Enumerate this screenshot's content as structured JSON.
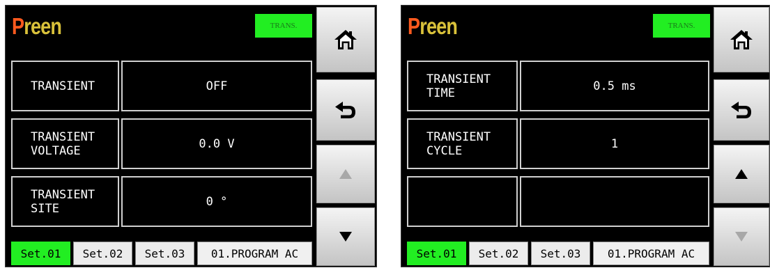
{
  "left": {
    "brand_first": "P",
    "brand_rest": "reen",
    "badge": "TRANS.",
    "rows": [
      {
        "label": "TRANSIENT",
        "value": "OFF"
      },
      {
        "label": "TRANSIENT\nVOLTAGE",
        "value": "0.0 V"
      },
      {
        "label": "TRANSIENT\nSITE",
        "value": "0 °"
      }
    ],
    "tabs": [
      "Set.01",
      "Set.02",
      "Set.03"
    ],
    "program": "01.PROGRAM AC",
    "up_enabled": false,
    "down_enabled": true
  },
  "right": {
    "brand_first": "P",
    "brand_rest": "reen",
    "badge": "TRANS.",
    "rows": [
      {
        "label": "TRANSIENT\nTIME",
        "value": "0.5 ms"
      },
      {
        "label": "TRANSIENT\nCYCLE",
        "value": "1"
      },
      {
        "label": "",
        "value": ""
      }
    ],
    "tabs": [
      "Set.01",
      "Set.02",
      "Set.03"
    ],
    "program": "01.PROGRAM AC",
    "up_enabled": true,
    "down_enabled": false
  },
  "icons": {
    "home": "home-icon",
    "back": "back-arrow-icon",
    "up": "up-triangle-icon",
    "down": "down-triangle-icon"
  },
  "colors": {
    "brand_first": "#ff5a1e",
    "brand_rest": "#d9c13a",
    "badge_bg": "#22ee22",
    "active_tab": "#22ee22",
    "enabled_arrow": "#000000",
    "disabled_arrow": "#a8a8a8"
  }
}
